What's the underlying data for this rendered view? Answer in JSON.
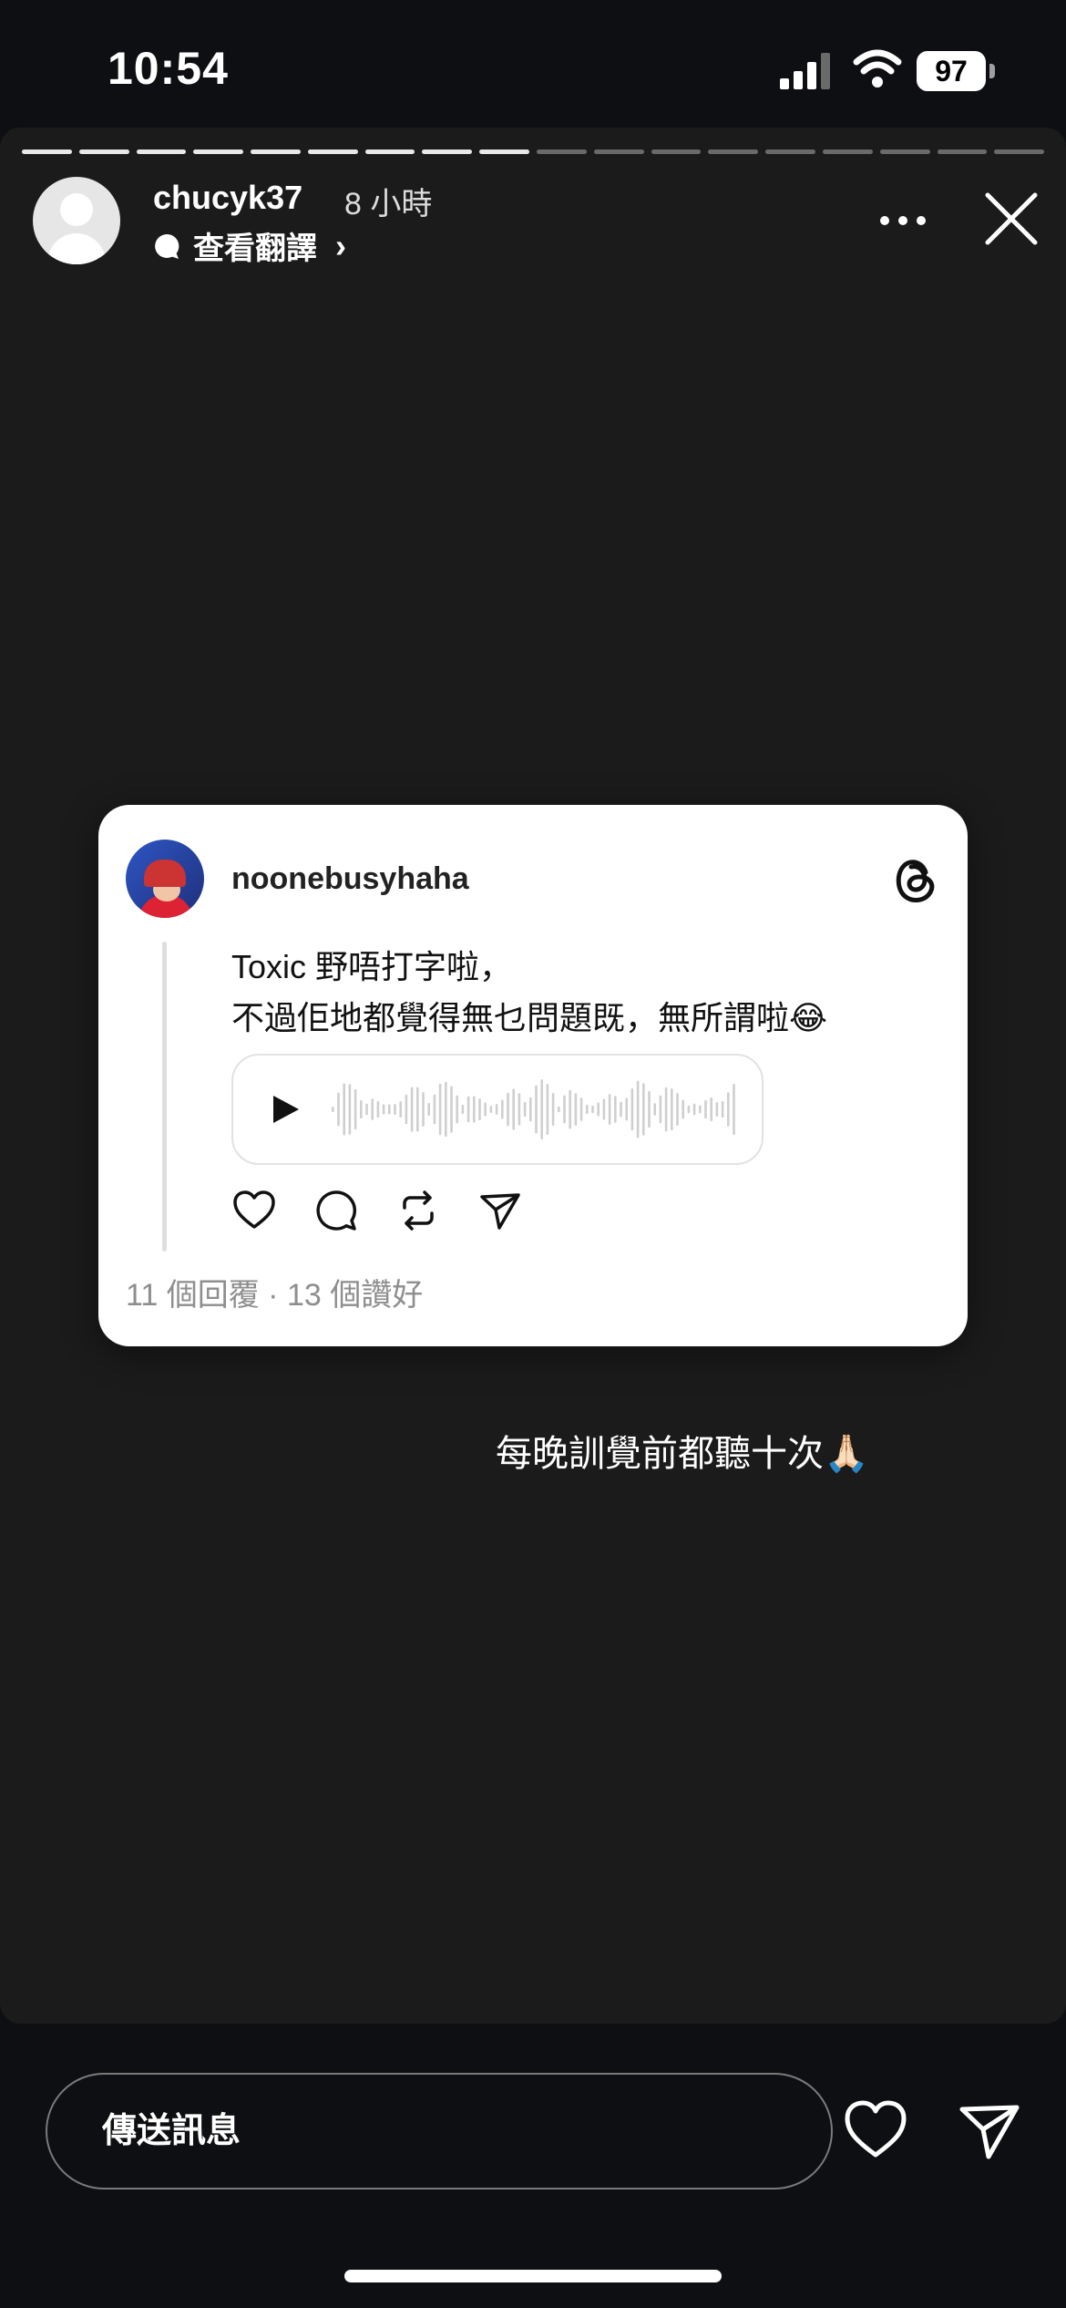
{
  "status_bar": {
    "time": "10:54",
    "battery": "97"
  },
  "story": {
    "progress_total": 18,
    "progress_done": 9,
    "username": "chucyk37",
    "time_ago": "8 小時",
    "translate_label": "查看翻譯"
  },
  "card": {
    "author": "noonebusyhaha",
    "text_line1": "Toxic 野唔打字啦，",
    "text_line2": "不過佢地都覺得無乜問題既，無所謂啦😂",
    "stats": "11 個回覆 · 13 個讚好"
  },
  "caption": "每晚訓覺前都聽十次🙏🏻",
  "reply": {
    "placeholder": "傳送訊息"
  },
  "icons": {
    "close": "close-icon",
    "more": "more-icon",
    "threads": "threads-logo-icon",
    "heart": "heart-icon",
    "send": "send-icon"
  }
}
